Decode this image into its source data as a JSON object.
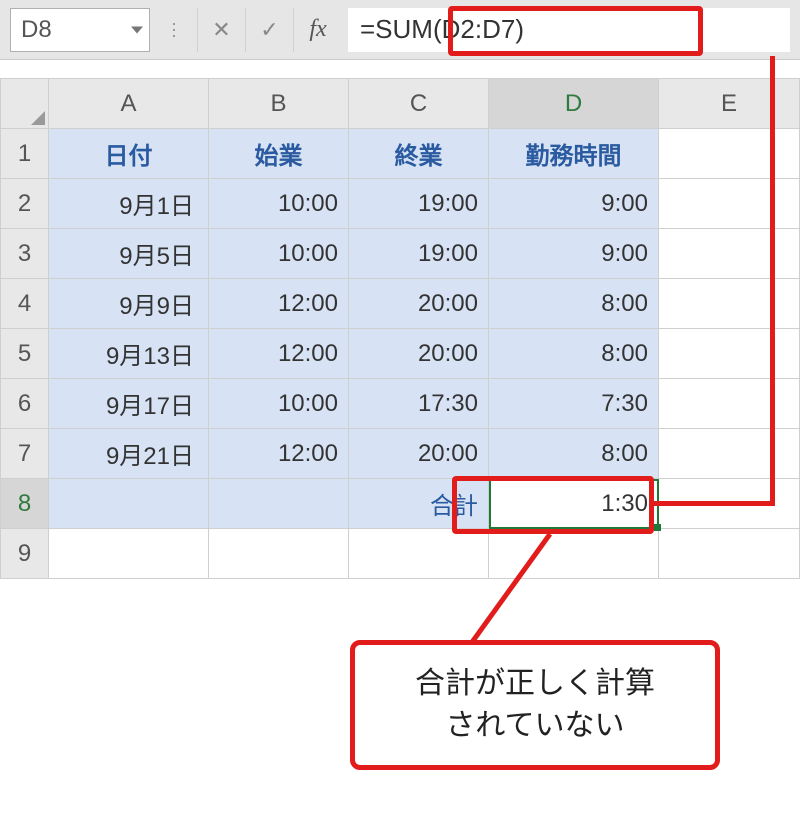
{
  "formula_bar": {
    "cell_ref": "D8",
    "cancel_glyph": "✕",
    "enter_glyph": "✓",
    "fx_label": "fx",
    "formula": "=SUM(D2:D7)"
  },
  "columns": [
    "A",
    "B",
    "C",
    "D",
    "E"
  ],
  "row_numbers": [
    "1",
    "2",
    "3",
    "4",
    "5",
    "6",
    "7",
    "8",
    "9"
  ],
  "headers": {
    "A": "日付",
    "B": "始業",
    "C": "終業",
    "D": "勤務時間"
  },
  "rows": [
    {
      "A": "9月1日",
      "B": "10:00",
      "C": "19:00",
      "D": "9:00"
    },
    {
      "A": "9月5日",
      "B": "10:00",
      "C": "19:00",
      "D": "9:00"
    },
    {
      "A": "9月9日",
      "B": "12:00",
      "C": "20:00",
      "D": "8:00"
    },
    {
      "A": "9月13日",
      "B": "12:00",
      "C": "20:00",
      "D": "8:00"
    },
    {
      "A": "9月17日",
      "B": "10:00",
      "C": "17:30",
      "D": "7:30"
    },
    {
      "A": "9月21日",
      "B": "12:00",
      "C": "20:00",
      "D": "8:00"
    }
  ],
  "total": {
    "label": "合計",
    "value": "1:30"
  },
  "callout_text": "合計が正しく計算\nされていない",
  "active_cell": "D8",
  "colors": {
    "highlight": "#e21b1b",
    "selection": "#d7e3f4",
    "active_border": "#1f7a3a",
    "header_text": "#2a5aa0"
  }
}
